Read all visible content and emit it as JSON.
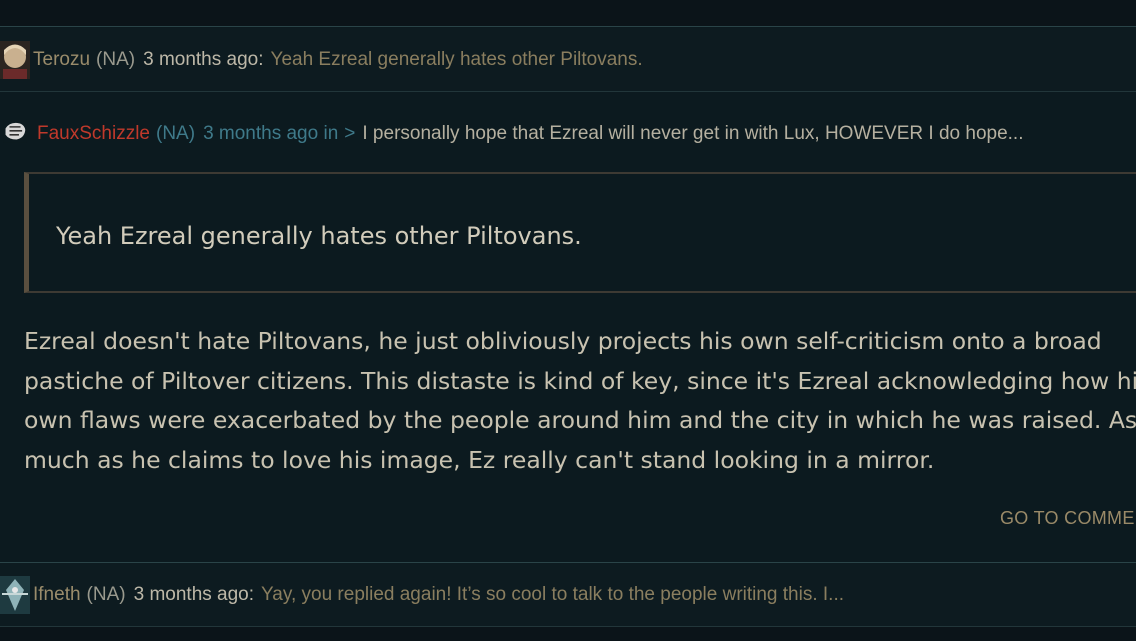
{
  "comments": [
    {
      "author": "Terozu",
      "region": "(NA)",
      "time": "3 months ago:",
      "preview": "Yeah Ezreal generally hates other Piltovans."
    },
    {
      "author": "FauxSchizzle",
      "region": "(NA)",
      "time": "3 months ago in",
      "chevron": ">",
      "preview": "I personally hope that Ezreal will never get in with Lux, HOWEVER I do hope...",
      "quote": "Yeah Ezreal generally hates other Piltovans.",
      "body_lines": [
        "Ezreal doesn't hate Piltovans, he just obliviously projects his own self-criticism onto a broad",
        "pastiche of Piltover citizens. This distaste is kind of key, since it's Ezreal acknowledging how his",
        "own flaws were exacerbated by the people around him and the city in which he was raised. As",
        "much as he claims to love his image, Ez really can't stand looking in a mirror."
      ],
      "go_to_label": "GO TO COMME"
    },
    {
      "author": "Ifneth",
      "region": "(NA)",
      "time": "3 months ago:",
      "preview": "Yay, you replied again! It’s so cool to talk to the people writing this. I..."
    }
  ]
}
